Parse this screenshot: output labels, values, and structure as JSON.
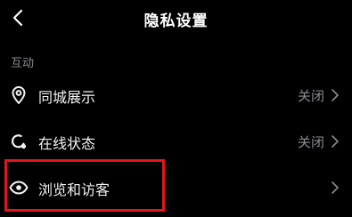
{
  "header": {
    "title": "隐私设置",
    "back_icon": "chevron-left-icon"
  },
  "section": {
    "label": "互动"
  },
  "rows": [
    {
      "label": "同城展示",
      "value": "关闭",
      "icon": "location-pin-icon"
    },
    {
      "label": "在线状态",
      "value": "关闭",
      "icon": "online-status-icon"
    },
    {
      "label": "浏览和访客",
      "value": "",
      "icon": "eye-icon"
    }
  ],
  "colors": {
    "background": "#000000",
    "primary_text": "#f2f2f2",
    "secondary_text": "#8a8b91",
    "highlight": "#e5151c"
  }
}
